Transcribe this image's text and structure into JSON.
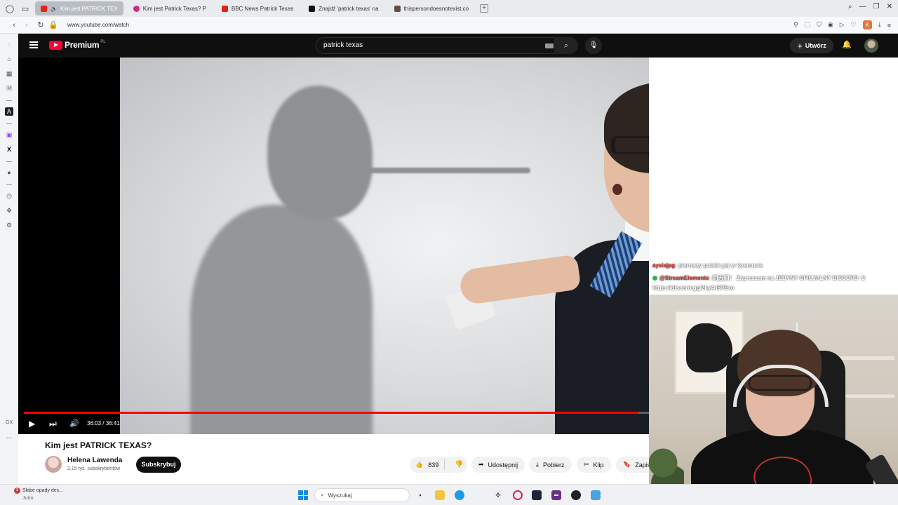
{
  "browser": {
    "tabs": [
      {
        "label": "Kim jest PATRICK TEX",
        "color": "#e62117",
        "active": true
      },
      {
        "label": "Kim jest Patrick Texas? P",
        "color": "#d42a7a",
        "active": false
      },
      {
        "label": "BBC News Patrick Texas",
        "color": "#e62117",
        "active": false
      },
      {
        "label": "Znajdź 'patrick texas' na",
        "color": "#111111",
        "active": false
      },
      {
        "label": "thispersondoesnotexist.co",
        "color": "#6b4a3a",
        "active": false
      }
    ],
    "url": "www.youtube.com/watch",
    "profile_letter": "K"
  },
  "youtube": {
    "logo_text": "Premium",
    "logo_country": "PL",
    "search_value": "patrick texas",
    "create_label": "Utwórz"
  },
  "player": {
    "time_display": "36:03 / 36:41",
    "progress": 0.9827
  },
  "video": {
    "title": "Kim jest PATRICK TEXAS?",
    "channel_name": "Helena Lawenda",
    "subscribers": "2,15 tys. subskrybentów",
    "subscribe_label": "Subskrybuj",
    "likes": "839",
    "share_label": "Udostępnij",
    "download_label": "Pobierz",
    "clip_label": "Klip",
    "save_label": "Zapis"
  },
  "chat": {
    "lines": [
      {
        "nick": "aysiajpg",
        "text": ": pierwszy polski gej w kosmosie"
      },
      {
        "nick": "@StreamElements",
        "text": ": 同志们！ Zapraszam na JEDYNY OFICJALNY DISCORD :3"
      },
      {
        "nick": "",
        "text": "https://discord.gg/2ky4d5PExu"
      }
    ]
  },
  "taskbar": {
    "weather_badge": "3",
    "weather_title": "Słabe opady des...",
    "weather_sub": "Jutro",
    "search_placeholder": "Wyszukaj",
    "tray_left": "GX"
  }
}
